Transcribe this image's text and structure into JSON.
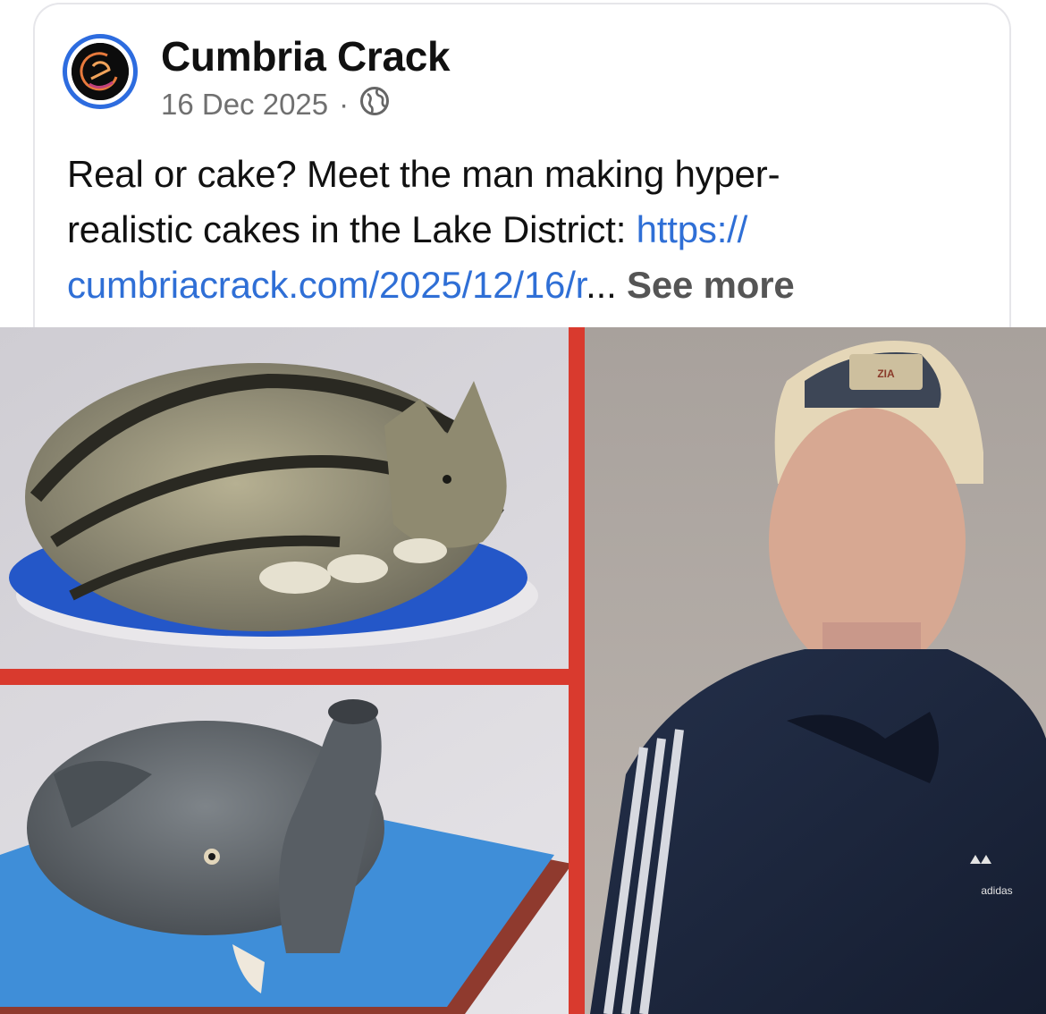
{
  "post": {
    "page_name": "Cumbria Crack",
    "date": "16 Dec 2025",
    "separator": "·",
    "audience_icon": "globe-icon",
    "text_line_1": "Real or cake? Meet the man making hyper-",
    "text_line_2_plain": "realistic cakes in the Lake District: ",
    "text_line_2_link": "https://",
    "text_line_3_link": "cumbriacrack.com/2025/12/16/r",
    "ellipsis": "... ",
    "see_more": "See more"
  },
  "image": {
    "panels": [
      "cat-cake-photo",
      "elephant-cake-photo",
      "man-portrait-photo"
    ],
    "cap_patch_text": "ZIA",
    "jacket_logo_text": "adidas"
  },
  "colors": {
    "link": "#2f6fd6",
    "avatar_ring": "#2d6cdf",
    "collage_border": "#d93a2e",
    "muted_text": "#707070"
  }
}
